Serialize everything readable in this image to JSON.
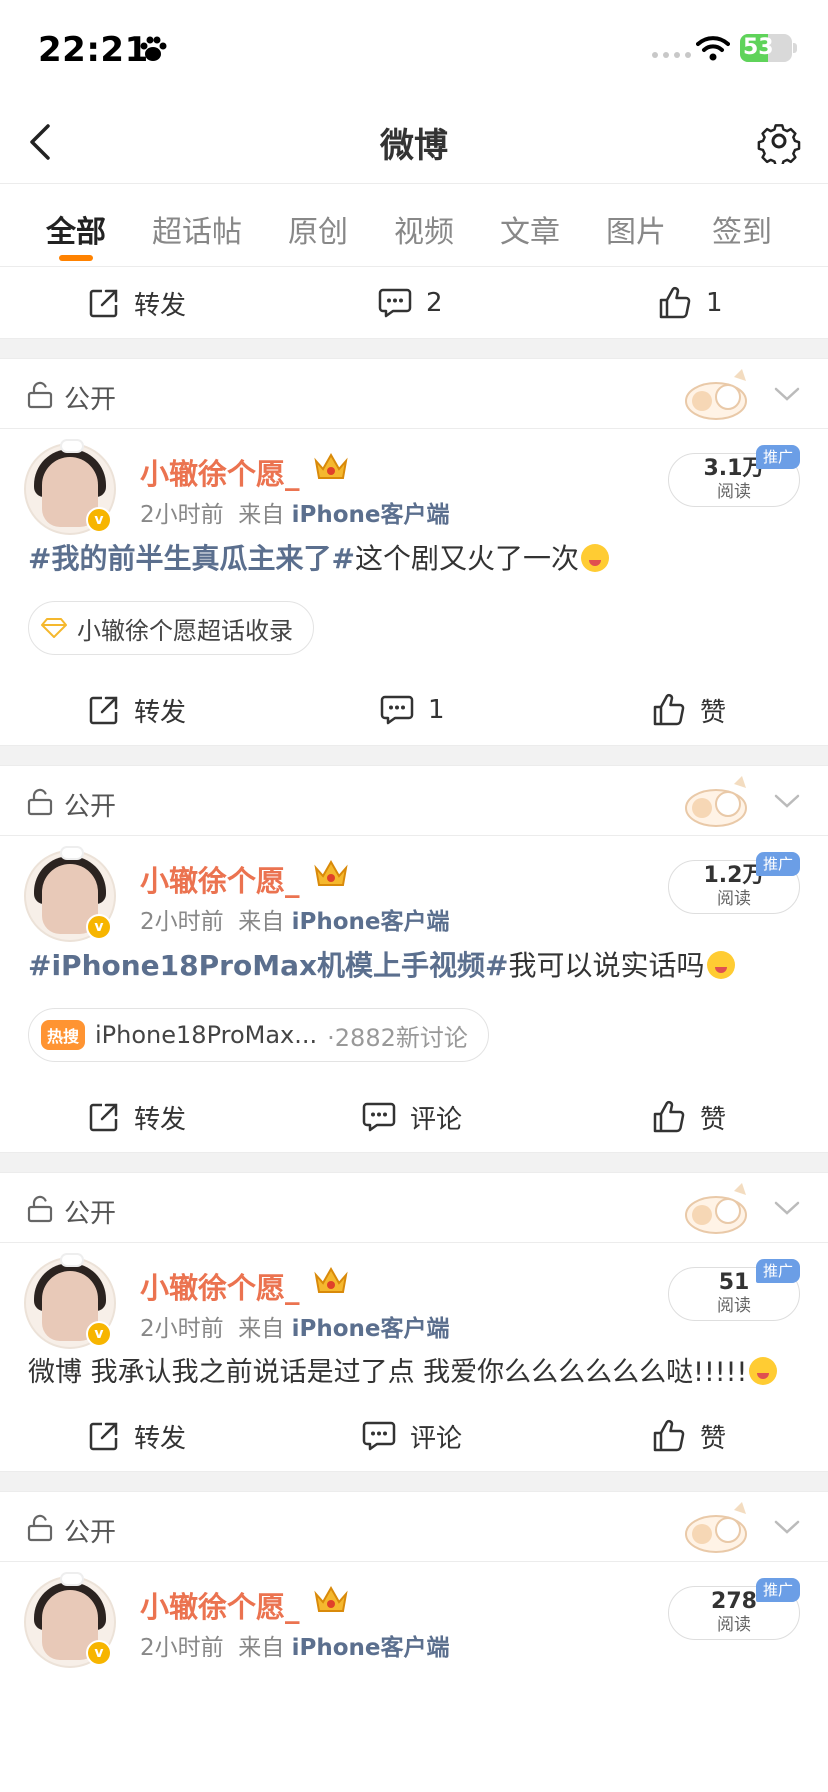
{
  "status_bar": {
    "time": "22:21",
    "battery": "53",
    "battery_level": 0.53
  },
  "nav": {
    "title": "微博"
  },
  "tabs": [
    {
      "label": "全部",
      "active": true
    },
    {
      "label": "超话帖",
      "active": false
    },
    {
      "label": "原创",
      "active": false
    },
    {
      "label": "视频",
      "active": false
    },
    {
      "label": "文章",
      "active": false
    },
    {
      "label": "图片",
      "active": false
    },
    {
      "label": "签到",
      "active": false
    }
  ],
  "top_actions": {
    "repost": "转发",
    "comment": "2",
    "like": "1"
  },
  "posts": [
    {
      "visibility": "公开",
      "author": "小辙徐个愿_",
      "time": "2小时前",
      "from_prefix": "来自",
      "source": "iPhone客户端",
      "reads": "3.1万",
      "reads_label": "阅读",
      "promo": "推广",
      "topic": "#我的前半生真瓜主来了#",
      "text": "这个剧又火了一次",
      "chip": "小辙徐个愿超话收录",
      "actions": {
        "repost": "转发",
        "comment": "1",
        "like": "赞"
      }
    },
    {
      "visibility": "公开",
      "author": "小辙徐个愿_",
      "time": "2小时前",
      "from_prefix": "来自",
      "source": "iPhone客户端",
      "reads": "1.2万",
      "reads_label": "阅读",
      "promo": "推广",
      "topic": "#iPhone18ProMax机模上手视频#",
      "text": "我可以说实话吗",
      "hot_tag": "热搜",
      "chip": "iPhone18ProMax...",
      "chip_count": "·2882新讨论",
      "actions": {
        "repost": "转发",
        "comment": "评论",
        "like": "赞"
      }
    },
    {
      "visibility": "公开",
      "author": "小辙徐个愿_",
      "time": "2小时前",
      "from_prefix": "来自",
      "source": "iPhone客户端",
      "reads": "51",
      "reads_label": "阅读",
      "promo": "推广",
      "text": "微博 我承认我之前说话是过了点 我爱你么么么么么么哒!!!!!",
      "actions": {
        "repost": "转发",
        "comment": "评论",
        "like": "赞"
      }
    },
    {
      "visibility": "公开",
      "author": "小辙徐个愿_",
      "time": "2小时前",
      "from_prefix": "来自",
      "source": "iPhone客户端",
      "reads": "278",
      "reads_label": "阅读",
      "promo": "推广"
    }
  ],
  "icons": {
    "repost": "share-box-icon",
    "comment": "speech-bubble-icon",
    "like": "thumbs-up-icon",
    "lock": "unlock-icon",
    "settings": "gear-icon",
    "back": "chevron-left-icon"
  },
  "colors": {
    "accent": "#ff8200",
    "name": "#eb7350",
    "topic": "#5b6f8e",
    "promo": "#6b9ee6"
  }
}
